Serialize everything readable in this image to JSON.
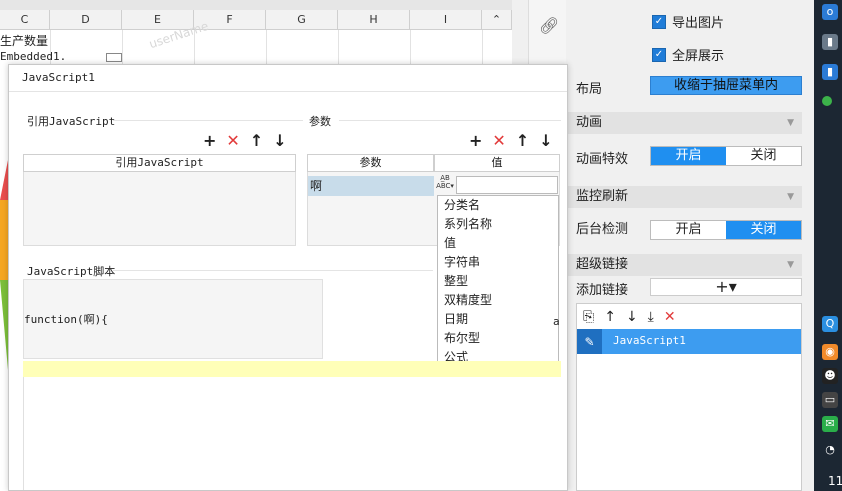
{
  "sheet": {
    "columns": [
      "C",
      "D",
      "E",
      "F",
      "G",
      "H",
      "I"
    ],
    "cell_c2": "生产数量",
    "cell_c3": "Embedded1.",
    "watermark": "userName"
  },
  "dialog": {
    "title": "JavaScript1",
    "ref_section": "引用JavaScript",
    "ref_column": "引用JavaScript",
    "param_section": "参数",
    "param_col_name": "参数",
    "param_col_value": "值",
    "param_row_name": "啊",
    "type_icon": "A̲B\nABC",
    "type_options": [
      "分类名",
      "系列名称",
      "值",
      "字符串",
      "整型",
      "双精度型",
      "日期",
      "布尔型",
      "公式"
    ],
    "script_section": "JavaScript脚本",
    "script_code": "function(啊){",
    "right_edge_char": "a"
  },
  "tools": {
    "add": "+",
    "delete": "✕",
    "up": "↑",
    "down": "↓"
  },
  "panel": {
    "export_image": "导出图片",
    "fullscreen": "全屏展示",
    "layout_label": "布局",
    "layout_value": "收缩于抽屉菜单内",
    "animation_section": "动画",
    "animation_effect_label": "动画特效",
    "animation_on": "开启",
    "animation_off": "关闭",
    "monitor_section": "监控刷新",
    "background_check_label": "后台检测",
    "bg_on": "开启",
    "bg_off": "关闭",
    "hyperlink_section": "超级链接",
    "add_link_label": "添加链接",
    "add_link_button": "+▾",
    "link_item": "JavaScript1"
  },
  "taskbar": {
    "clock": "11"
  },
  "colors": {
    "accent": "#3d9cf0",
    "toggle_on": "#1f8ff0",
    "delete_red": "#e23a3a",
    "selected_cell": "#c8dcea",
    "hint_yellow": "#ffffb8"
  }
}
